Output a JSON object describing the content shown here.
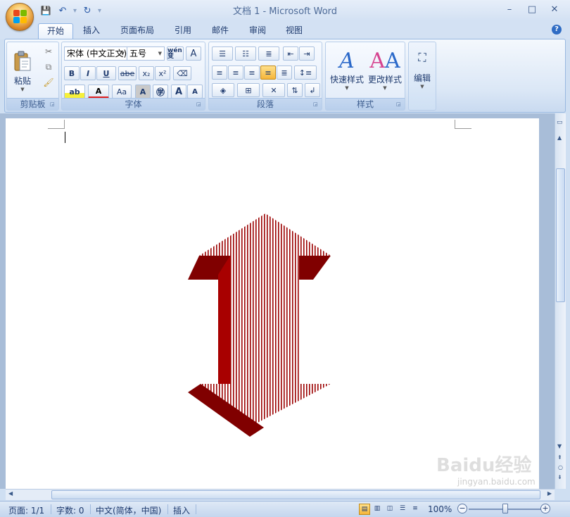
{
  "window": {
    "title": "文档 1 - Microsoft Word",
    "controls": {
      "minimize": "–",
      "maximize": "□",
      "close": "✕"
    }
  },
  "quick_access": {
    "save": "💾",
    "undo": "↶",
    "redo": "↻",
    "customize": "▾"
  },
  "tabs": [
    {
      "label": "开始",
      "active": true
    },
    {
      "label": "插入",
      "active": false
    },
    {
      "label": "页面布局",
      "active": false
    },
    {
      "label": "引用",
      "active": false
    },
    {
      "label": "邮件",
      "active": false
    },
    {
      "label": "审阅",
      "active": false
    },
    {
      "label": "视图",
      "active": false
    }
  ],
  "help": "?",
  "ribbon": {
    "clipboard": {
      "label": "剪贴板",
      "paste": "粘贴"
    },
    "font": {
      "label": "字体",
      "font_name": "宋体 (中文正文)",
      "font_size": "五号",
      "bold": "B",
      "italic": "I",
      "underline": "U",
      "strike": "abe",
      "subscript": "x₂",
      "superscript": "x²",
      "grow": "A",
      "shrink": "A",
      "change_case": "Aa",
      "wen": "wén 变"
    },
    "paragraph": {
      "label": "段落"
    },
    "styles": {
      "label": "样式",
      "quick_styles": "快速样式",
      "change_styles": "更改样式"
    },
    "editing": {
      "label": "编辑"
    }
  },
  "status": {
    "page": "页面: 1/1",
    "words": "字数: 0",
    "language": "中文(简体，中国)",
    "mode": "插入",
    "zoom": "100%",
    "zoom_level": 1.0
  },
  "watermark": {
    "main": "Baidu经验",
    "sub": "jingyan.baidu.com"
  },
  "colors": {
    "arrow_dark": "#8b0000",
    "arrow_mid": "#a80000",
    "ribbon_border": "#99b8e0"
  }
}
